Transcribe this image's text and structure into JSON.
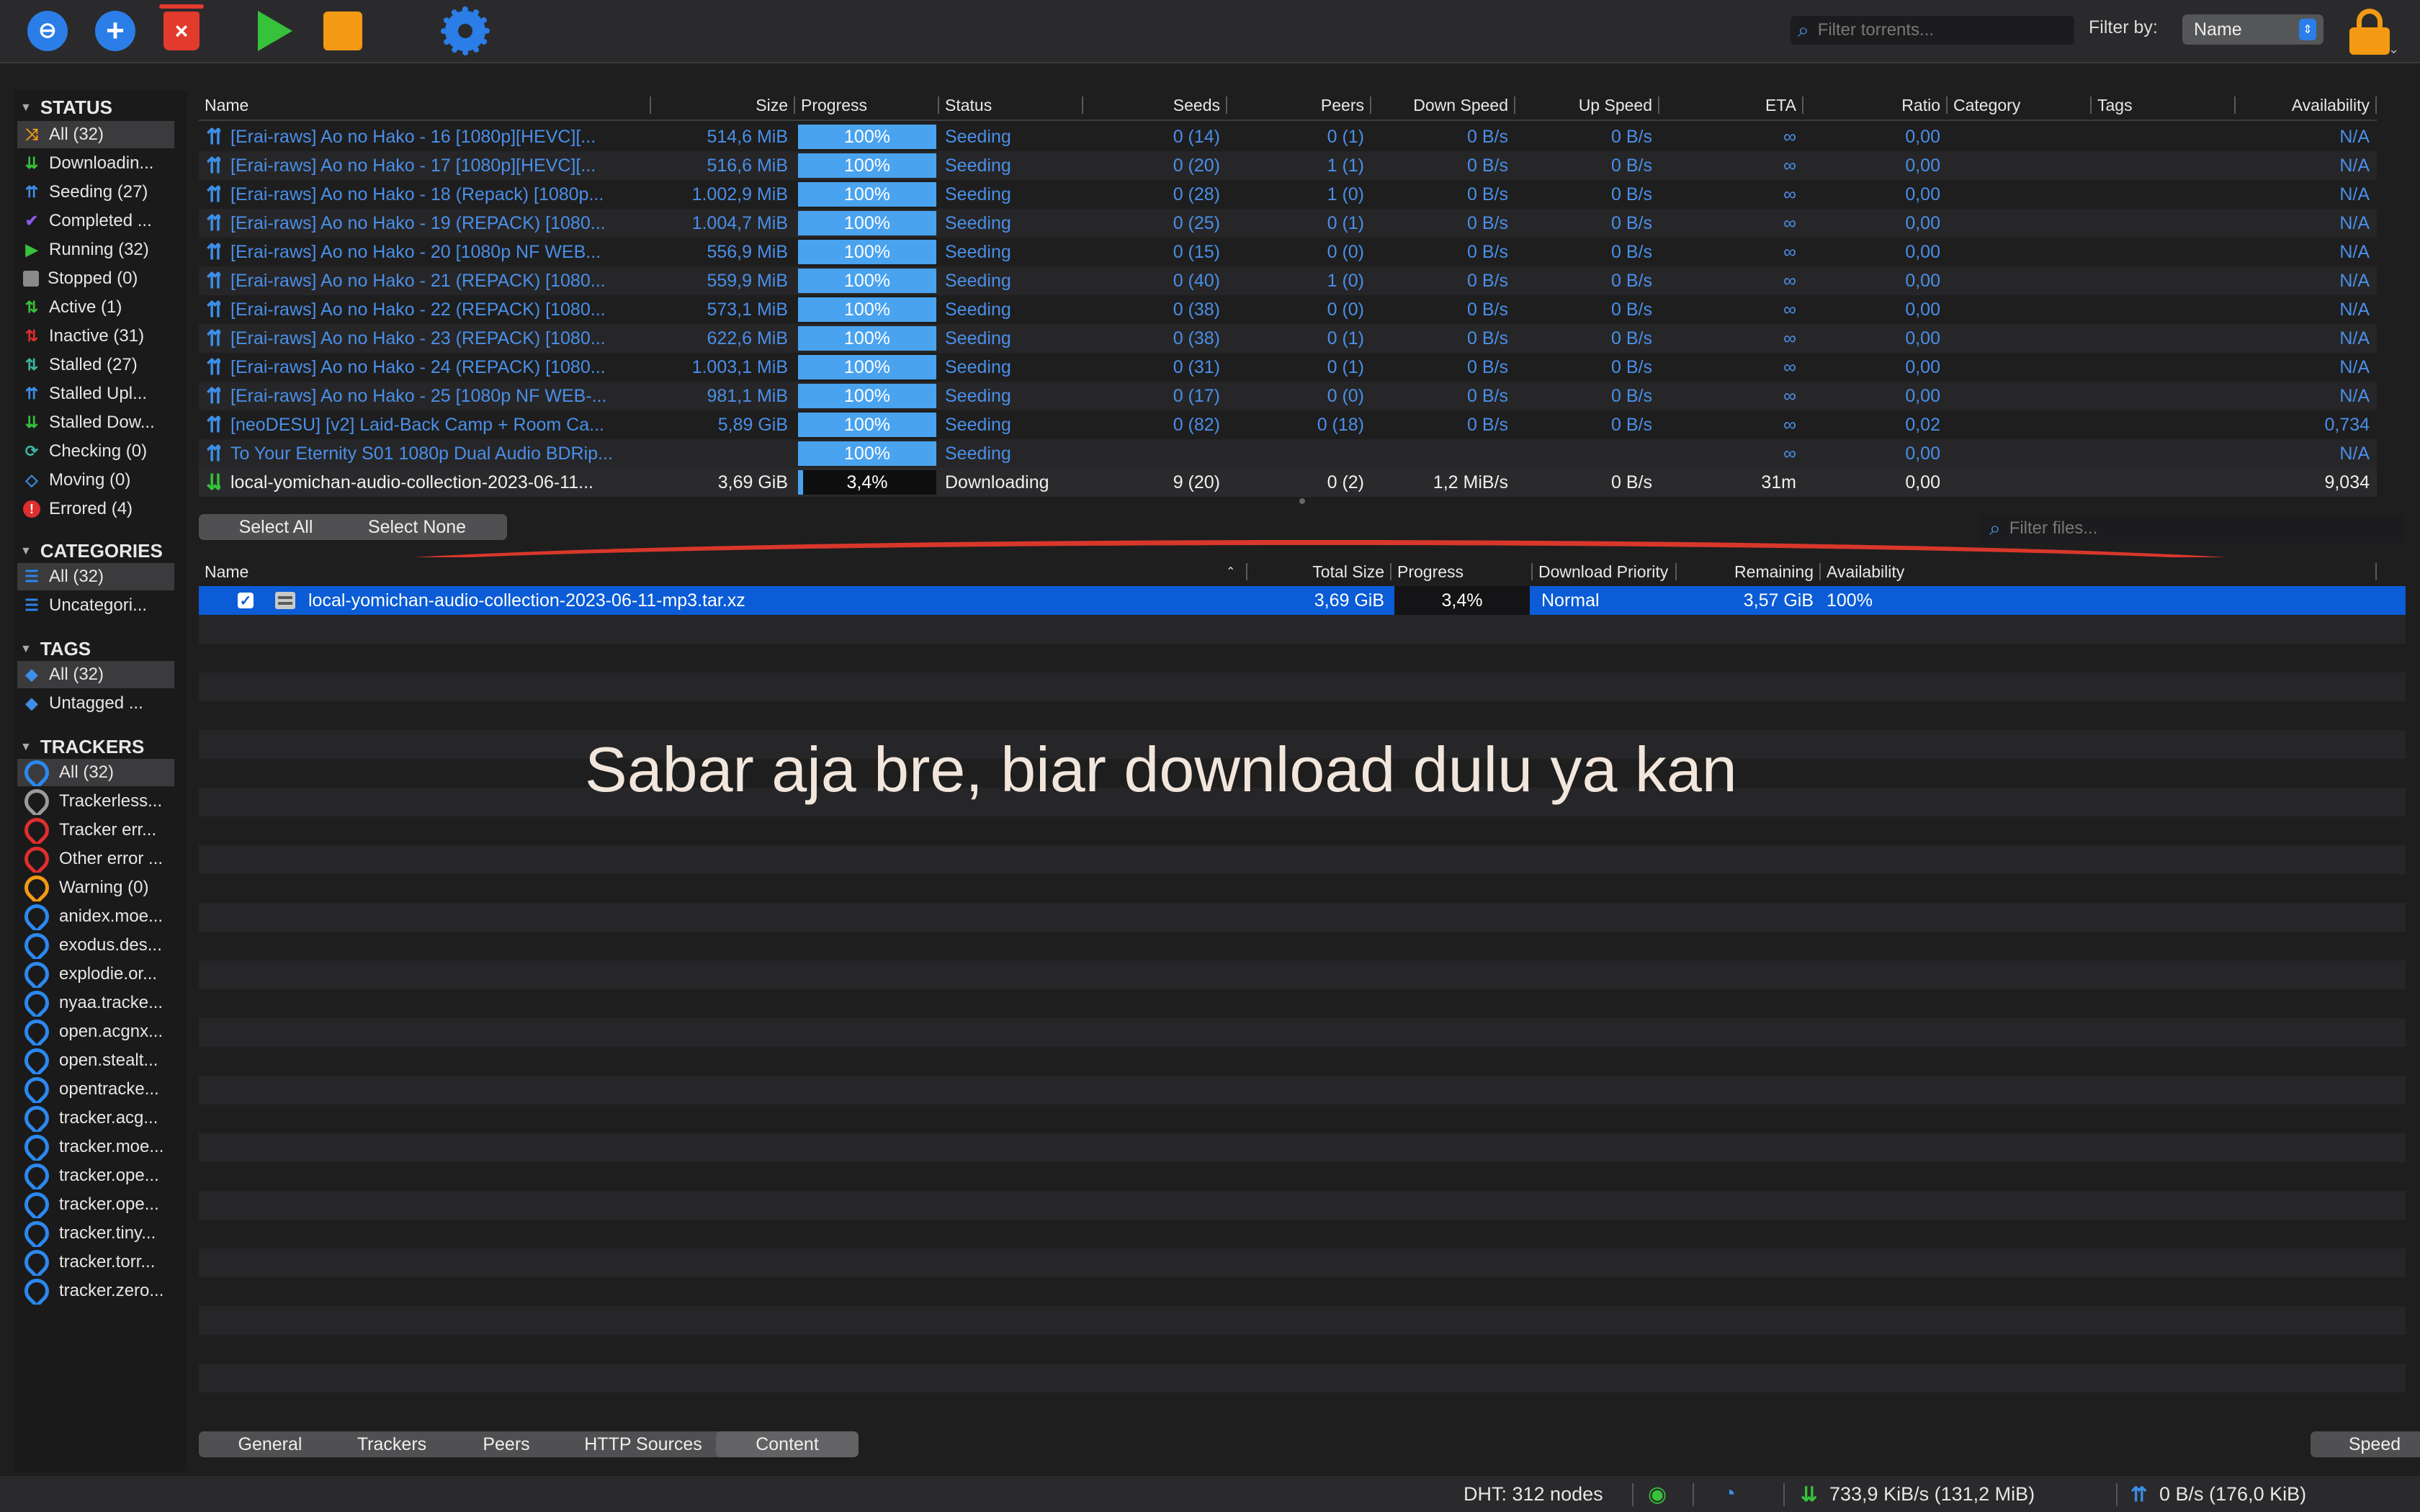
{
  "toolbar": {
    "search_placeholder": "Filter torrents...",
    "filter_label": "Filter by:",
    "filter_value": "Name",
    "colors": {
      "accent": "#2b7ee8",
      "delete": "#e23a2c",
      "start": "#36c23a",
      "stop": "#f39a12"
    }
  },
  "sidebar": {
    "status": {
      "title": "STATUS",
      "items": [
        {
          "label": "All (32)",
          "icon": "shuffle-icon"
        },
        {
          "label": "Downloadin...",
          "icon": "download-icon"
        },
        {
          "label": "Seeding (27)",
          "icon": "upload-icon"
        },
        {
          "label": "Completed ...",
          "icon": "checkmark-icon"
        },
        {
          "label": "Running (32)",
          "icon": "play-icon"
        },
        {
          "label": "Stopped (0)",
          "icon": "stop-icon"
        },
        {
          "label": "Active (1)",
          "icon": "active-arrows-icon"
        },
        {
          "label": "Inactive (31)",
          "icon": "inactive-arrows-icon"
        },
        {
          "label": "Stalled (27)",
          "icon": "stalled-arrows-icon"
        },
        {
          "label": "Stalled Upl...",
          "icon": "stalled-upload-icon"
        },
        {
          "label": "Stalled Dow...",
          "icon": "stalled-download-icon"
        },
        {
          "label": "Checking (0)",
          "icon": "checking-icon"
        },
        {
          "label": "Moving (0)",
          "icon": "moving-icon"
        },
        {
          "label": "Errored (4)",
          "icon": "error-icon"
        }
      ]
    },
    "categories": {
      "title": "CATEGORIES",
      "items": [
        {
          "label": "All (32)"
        },
        {
          "label": "Uncategori..."
        }
      ]
    },
    "tags": {
      "title": "TAGS",
      "items": [
        {
          "label": "All (32)"
        },
        {
          "label": "Untagged ..."
        }
      ]
    },
    "trackers": {
      "title": "TRACKERS",
      "items": [
        {
          "label": "All (32)",
          "color": "blue"
        },
        {
          "label": "Trackerless...",
          "color": "gray"
        },
        {
          "label": "Tracker err...",
          "color": "red"
        },
        {
          "label": "Other error ...",
          "color": "red"
        },
        {
          "label": "Warning (0)",
          "color": "orange"
        },
        {
          "label": "anidex.moe...",
          "color": "blue"
        },
        {
          "label": "exodus.des...",
          "color": "blue"
        },
        {
          "label": "explodie.or...",
          "color": "blue"
        },
        {
          "label": "nyaa.tracke...",
          "color": "blue"
        },
        {
          "label": "open.acgnx...",
          "color": "blue"
        },
        {
          "label": "open.stealt...",
          "color": "blue"
        },
        {
          "label": "opentracke...",
          "color": "blue"
        },
        {
          "label": "tracker.acg...",
          "color": "blue"
        },
        {
          "label": "tracker.moe...",
          "color": "blue"
        },
        {
          "label": "tracker.ope...",
          "color": "blue"
        },
        {
          "label": "tracker.ope...",
          "color": "blue"
        },
        {
          "label": "tracker.tiny...",
          "color": "blue"
        },
        {
          "label": "tracker.torr...",
          "color": "blue"
        },
        {
          "label": "tracker.zero...",
          "color": "blue"
        }
      ]
    }
  },
  "torrents": {
    "columns": [
      "Name",
      "Size",
      "Progress",
      "Status",
      "Seeds",
      "Peers",
      "Down Speed",
      "Up Speed",
      "ETA",
      "Ratio",
      "Category",
      "Tags",
      "Availability"
    ],
    "rows": [
      {
        "name": "[Erai-raws] Ao no Hako - 16 [1080p][HEVC][...",
        "size": "514,6 MiB",
        "progress": "100%",
        "progress_value": 1.0,
        "status": "Seeding",
        "seeds": "0 (14)",
        "peers": "0 (1)",
        "down": "0 B/s",
        "up": "0 B/s",
        "eta": "∞",
        "ratio": "0,00",
        "availability": "N/A"
      },
      {
        "name": "[Erai-raws] Ao no Hako - 17 [1080p][HEVC][...",
        "size": "516,6 MiB",
        "progress": "100%",
        "progress_value": 1.0,
        "status": "Seeding",
        "seeds": "0 (20)",
        "peers": "1 (1)",
        "down": "0 B/s",
        "up": "0 B/s",
        "eta": "∞",
        "ratio": "0,00",
        "availability": "N/A"
      },
      {
        "name": "[Erai-raws] Ao no Hako - 18 (Repack) [1080p...",
        "size": "1.002,9 MiB",
        "progress": "100%",
        "progress_value": 1.0,
        "status": "Seeding",
        "seeds": "0 (28)",
        "peers": "1 (0)",
        "down": "0 B/s",
        "up": "0 B/s",
        "eta": "∞",
        "ratio": "0,00",
        "availability": "N/A"
      },
      {
        "name": "[Erai-raws] Ao no Hako - 19 (REPACK) [1080...",
        "size": "1.004,7 MiB",
        "progress": "100%",
        "progress_value": 1.0,
        "status": "Seeding",
        "seeds": "0 (25)",
        "peers": "0 (1)",
        "down": "0 B/s",
        "up": "0 B/s",
        "eta": "∞",
        "ratio": "0,00",
        "availability": "N/A"
      },
      {
        "name": "[Erai-raws] Ao no Hako - 20 [1080p NF WEB...",
        "size": "556,9 MiB",
        "progress": "100%",
        "progress_value": 1.0,
        "status": "Seeding",
        "seeds": "0 (15)",
        "peers": "0 (0)",
        "down": "0 B/s",
        "up": "0 B/s",
        "eta": "∞",
        "ratio": "0,00",
        "availability": "N/A"
      },
      {
        "name": "[Erai-raws] Ao no Hako - 21 (REPACK) [1080...",
        "size": "559,9 MiB",
        "progress": "100%",
        "progress_value": 1.0,
        "status": "Seeding",
        "seeds": "0 (40)",
        "peers": "1 (0)",
        "down": "0 B/s",
        "up": "0 B/s",
        "eta": "∞",
        "ratio": "0,00",
        "availability": "N/A"
      },
      {
        "name": "[Erai-raws] Ao no Hako - 22 (REPACK) [1080...",
        "size": "573,1 MiB",
        "progress": "100%",
        "progress_value": 1.0,
        "status": "Seeding",
        "seeds": "0 (38)",
        "peers": "0 (0)",
        "down": "0 B/s",
        "up": "0 B/s",
        "eta": "∞",
        "ratio": "0,00",
        "availability": "N/A"
      },
      {
        "name": "[Erai-raws] Ao no Hako - 23 (REPACK) [1080...",
        "size": "622,6 MiB",
        "progress": "100%",
        "progress_value": 1.0,
        "status": "Seeding",
        "seeds": "0 (38)",
        "peers": "0 (1)",
        "down": "0 B/s",
        "up": "0 B/s",
        "eta": "∞",
        "ratio": "0,00",
        "availability": "N/A"
      },
      {
        "name": "[Erai-raws] Ao no Hako - 24 (REPACK) [1080...",
        "size": "1.003,1 MiB",
        "progress": "100%",
        "progress_value": 1.0,
        "status": "Seeding",
        "seeds": "0 (31)",
        "peers": "0 (1)",
        "down": "0 B/s",
        "up": "0 B/s",
        "eta": "∞",
        "ratio": "0,00",
        "availability": "N/A"
      },
      {
        "name": "[Erai-raws] Ao no Hako - 25 [1080p NF WEB-...",
        "size": "981,1 MiB",
        "progress": "100%",
        "progress_value": 1.0,
        "status": "Seeding",
        "seeds": "0 (17)",
        "peers": "0 (0)",
        "down": "0 B/s",
        "up": "0 B/s",
        "eta": "∞",
        "ratio": "0,00",
        "availability": "N/A"
      },
      {
        "name": "[neoDESU] [v2] Laid-Back Camp + Room Ca...",
        "size": "5,89 GiB",
        "progress": "100%",
        "progress_value": 1.0,
        "status": "Seeding",
        "seeds": "0 (82)",
        "peers": "0 (18)",
        "down": "0 B/s",
        "up": "0 B/s",
        "eta": "∞",
        "ratio": "0,02",
        "availability": "0,734"
      },
      {
        "name": "To Your Eternity S01 1080p Dual Audio BDRip...",
        "size": "",
        "progress": "100%",
        "progress_value": 1.0,
        "status": "Seeding",
        "seeds": "",
        "peers": "",
        "down": "",
        "up": "",
        "eta": "∞",
        "ratio": "0,00",
        "availability": "N/A"
      },
      {
        "name": "local-yomichan-audio-collection-2023-06-11...",
        "size": "3,69 GiB",
        "progress": "3,4%",
        "progress_value": 0.034,
        "status": "Downloading",
        "seeds": "9 (20)",
        "peers": "0 (2)",
        "down": "1,2 MiB/s",
        "up": "0 B/s",
        "eta": "31m",
        "ratio": "0,00",
        "availability": "9,034"
      }
    ]
  },
  "content": {
    "select_all": "Select All",
    "select_none": "Select None",
    "filter_placeholder": "Filter files...",
    "columns": [
      "Name",
      "Total Size",
      "Progress",
      "Download Priority",
      "Remaining",
      "Availability"
    ],
    "file": {
      "name": "local-yomichan-audio-collection-2023-06-11-mp3.tar.xz",
      "total_size": "3,69 GiB",
      "progress": "3,4%",
      "priority": "Normal",
      "remaining": "3,57 GiB",
      "availability": "100%"
    }
  },
  "overlay_caption": "Sabar aja bre, biar download dulu ya kan",
  "bottom_tabs": [
    "General",
    "Trackers",
    "Peers",
    "HTTP Sources",
    "Content"
  ],
  "speed_button": "Speed",
  "statusbar": {
    "dht": "DHT: 312 nodes",
    "download": "733,9 KiB/s (131,2 MiB)",
    "upload": "0 B/s (176,0 KiB)"
  }
}
